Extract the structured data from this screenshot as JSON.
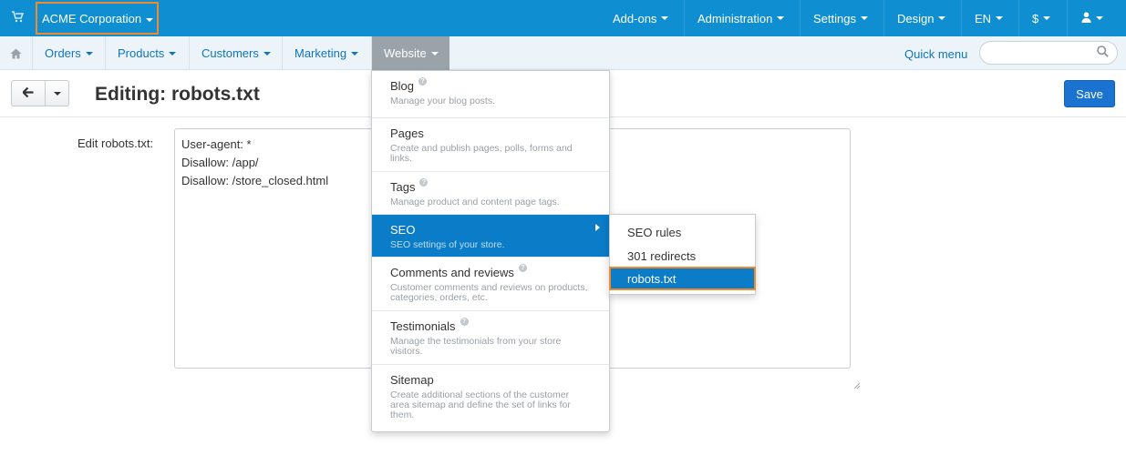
{
  "topbar": {
    "company": "ACME Corporation",
    "nav": [
      "Add-ons",
      "Administration",
      "Settings",
      "Design",
      "EN",
      "$"
    ]
  },
  "navbar": {
    "items": [
      "Orders",
      "Products",
      "Customers",
      "Marketing",
      "Website"
    ],
    "quick_menu": "Quick menu",
    "search_placeholder": ""
  },
  "actionbar": {
    "title": "Editing: robots.txt",
    "save_label": "Save"
  },
  "form": {
    "label": "Edit robots.txt:",
    "content": "User-agent: *\nDisallow: /app/\nDisallow: /store_closed.html"
  },
  "website_menu": [
    {
      "title": "Blog",
      "desc": "Manage your blog posts."
    },
    {
      "title": "Pages",
      "desc": "Create and publish pages, polls, forms and links."
    },
    {
      "title": "Tags",
      "desc": "Manage product and content page tags."
    },
    {
      "title": "SEO",
      "desc": "SEO settings of your store."
    },
    {
      "title": "Comments and reviews",
      "desc": "Customer comments and reviews on products, categories, orders, etc."
    },
    {
      "title": "Testimonials",
      "desc": "Manage the testimonials from your store visitors."
    },
    {
      "title": "Sitemap",
      "desc": "Create additional sections of the customer area sitemap and define the set of links for them."
    }
  ],
  "seo_submenu": [
    "SEO rules",
    "301 redirects",
    "robots.txt"
  ],
  "colors": {
    "topbar": "#0f8fd1",
    "highlight_border": "#f08a2c",
    "active_item": "#0b7cc7",
    "save_button": "#1a73d0"
  }
}
